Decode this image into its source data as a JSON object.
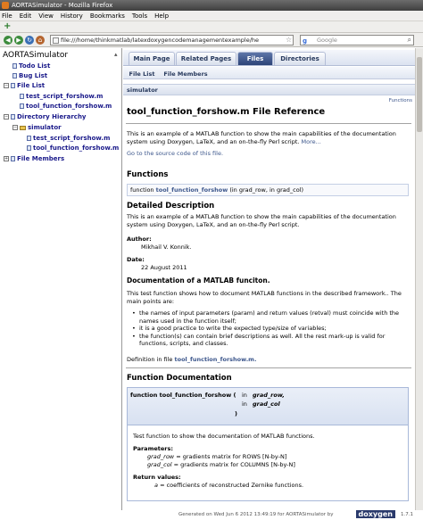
{
  "window": {
    "title": "AORTASimulator - Mozilla Firefox"
  },
  "menu": [
    "File",
    "Edit",
    "View",
    "History",
    "Bookmarks",
    "Tools",
    "Help"
  ],
  "nav": {
    "url": "file:///home/thinkmatlab/latexdoxygencodemanagementexample/he",
    "search_placeholder": "Google"
  },
  "sidebar": {
    "title": "AORTASimulator",
    "items": [
      {
        "label": "Todo List",
        "toggle": ""
      },
      {
        "label": "Bug List",
        "toggle": ""
      },
      {
        "label": "File List",
        "toggle": "−"
      },
      {
        "label": "test_script_forshow.m",
        "toggle": ""
      },
      {
        "label": "tool_function_forshow.m",
        "toggle": ""
      },
      {
        "label": "Directory Hierarchy",
        "toggle": "−"
      },
      {
        "label": "simulator",
        "toggle": "−"
      },
      {
        "label": "test_script_forshow.m",
        "toggle": ""
      },
      {
        "label": "tool_function_forshow.m",
        "toggle": ""
      },
      {
        "label": "File Members",
        "toggle": "+"
      }
    ]
  },
  "tabs": [
    "Main Page",
    "Related Pages",
    "Files",
    "Directories"
  ],
  "subtabs": [
    "File List",
    "File Members"
  ],
  "breadcrumb": "simulator",
  "functions_link": "Functions",
  "doc": {
    "title": "tool_function_forshow.m File Reference",
    "intro": "This is an example of a MATLAB function to show the main capabilities of the documentation system using Doxygen, LaTeX, and an on-the-fly Perl script.",
    "more": "More...",
    "source_link": "Go to the source code of this file.",
    "functions_heading": "Functions",
    "func_sig_prefix": "function",
    "func_sig_name": "tool_function_forshow",
    "func_sig_args": "(in grad_row, in grad_col)",
    "detailed_heading": "Detailed Description",
    "detailed_text": "This is an example of a MATLAB function to show the main capabilities of the documentation system using Doxygen, LaTeX, and an on-the-fly Perl script.",
    "author_label": "Author:",
    "author": "Mikhail V. Konnik.",
    "date_label": "Date:",
    "date": "22 August 2011",
    "matlab_heading": "Documentation of a MATLAB funciton.",
    "matlab_intro": "This test function shows how to document MATLAB functions in the described framework.. The main points are:",
    "bullets": [
      "the names of input parameters (param) and return values (retval) must coincide with the names used in the function itself;",
      "it is a good practice to write the expected type/size of variables;",
      "the function(s) can contain brief descriptions as well. All the rest mark-up is valid for functions, scripts, and classes."
    ],
    "definition_prefix": "Definition in file",
    "definition_file": "tool_function_forshow.m.",
    "funcdoc_heading": "Function Documentation",
    "sig_line1": "function tool_function_forshow (",
    "sig_in1": "in",
    "sig_arg1": "grad_row,",
    "sig_in2": "in",
    "sig_arg2": "grad_col",
    "sig_close": ")",
    "funcdoc_desc": "Test function to show the documentation of MATLAB functions.",
    "params_label": "Parameters:",
    "param1_name": "grad_row",
    "param1_desc": "= gradients matrix for ROWS [N-by-N]",
    "param2_name": "grad_col",
    "param2_desc": "= gradients matrix for COLUMNS [N-by-N]",
    "return_label": "Return values:",
    "return_name": "a",
    "return_desc": "= coefficients of reconstructed Zernike functions."
  },
  "footer": {
    "generated": "Generated on Wed Jun 6 2012 13:49:19 for AORTASimulator by",
    "logo": "doxygen",
    "version": "1.7.1"
  }
}
